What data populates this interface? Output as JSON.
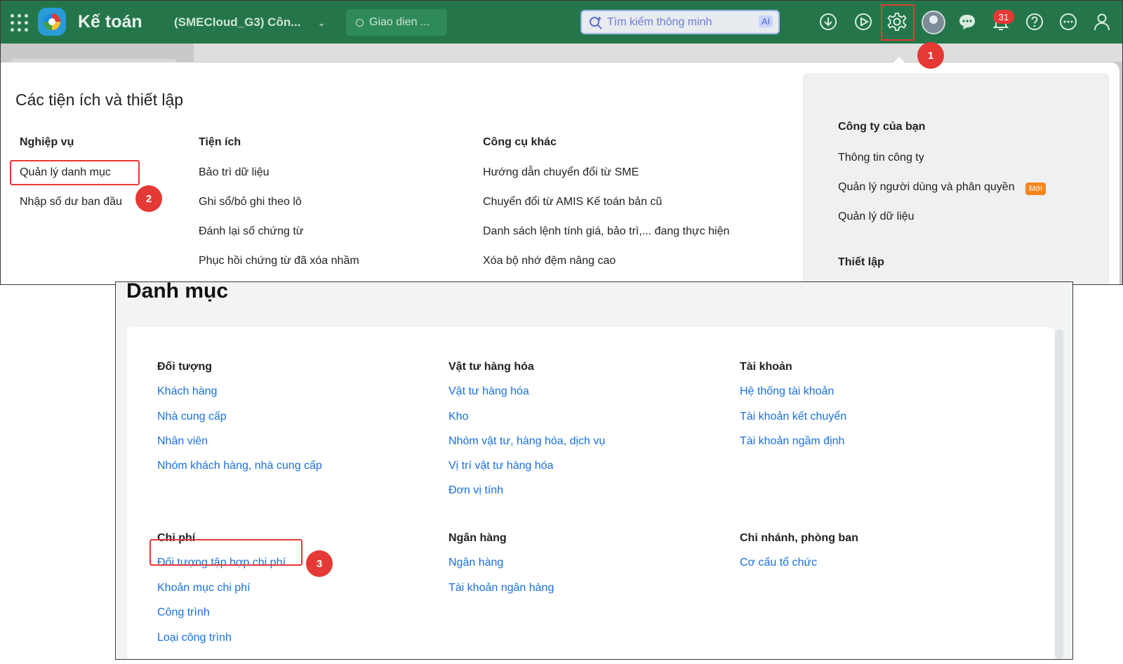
{
  "header": {
    "app_title": "Kế toán",
    "company": "(SMECloud_G3) Côn...",
    "theme_label": "Giao dien ...",
    "search_placeholder": "Tìm kiếm thông minh",
    "ai_label": "AI",
    "notification_count": "31"
  },
  "colors": {
    "topbar": "#24764a",
    "highlight": "#e53935",
    "link": "#1a6fdc",
    "new_badge": "#f5861f"
  },
  "steps": [
    "1",
    "2",
    "3"
  ],
  "settings": {
    "title": "Các tiện ích và thiết lập",
    "columns": [
      {
        "heading": "Nghiệp vụ",
        "items": [
          "Quản lý danh mục",
          "Nhập số dư ban đầu"
        ]
      },
      {
        "heading": "Tiện ích",
        "items": [
          "Bảo trì dữ liệu",
          "Ghi sổ/bỏ ghi theo lô",
          "Đánh lại số chứng từ",
          "Phục hồi chứng từ đã xóa nhầm"
        ]
      },
      {
        "heading": "Công cụ khác",
        "items": [
          "Hướng dẫn chuyển đổi từ SME",
          "Chuyển đổi từ AMIS Kế toán bản cũ",
          "Danh sách lệnh tính giá, bảo trì,... đang thực hiện",
          "Xóa bộ nhớ đệm nâng cao"
        ]
      }
    ],
    "side": {
      "company_heading": "Công ty của bạn",
      "company_items": [
        "Thông tin công ty",
        "Quản lý người dùng và phân quyền",
        "Quản lý dữ liệu"
      ],
      "new_badge": "Mới",
      "setup_heading": "Thiết lập"
    }
  },
  "catalog": {
    "title": "Danh mục",
    "groups": [
      {
        "heading": "Đối tượng",
        "links": [
          "Khách hàng",
          "Nhà cung cấp",
          "Nhân viên",
          "Nhóm khách hàng, nhà cung cấp"
        ]
      },
      {
        "heading": "Vật tư hàng hóa",
        "links": [
          "Vật tư hàng hóa",
          "Kho",
          "Nhóm vật tư, hàng hóa, dịch vụ",
          "Vị trí vật tư hàng hóa",
          "Đơn vị tính"
        ]
      },
      {
        "heading": "Tài khoản",
        "links": [
          "Hệ thống tài khoản",
          "Tài khoản kết chuyển",
          "Tài khoản ngầm định"
        ]
      },
      {
        "heading": "Chi phí",
        "links": [
          "Đối tượng tập hợp chi phí",
          "Khoản mục chi phí",
          "Công trình",
          "Loại công trình"
        ]
      },
      {
        "heading": "Ngân hàng",
        "links": [
          "Ngân hàng",
          "Tài khoản ngân hàng"
        ]
      },
      {
        "heading": "Chi nhánh, phòng ban",
        "links": [
          "Cơ cấu tổ chức"
        ]
      }
    ]
  }
}
